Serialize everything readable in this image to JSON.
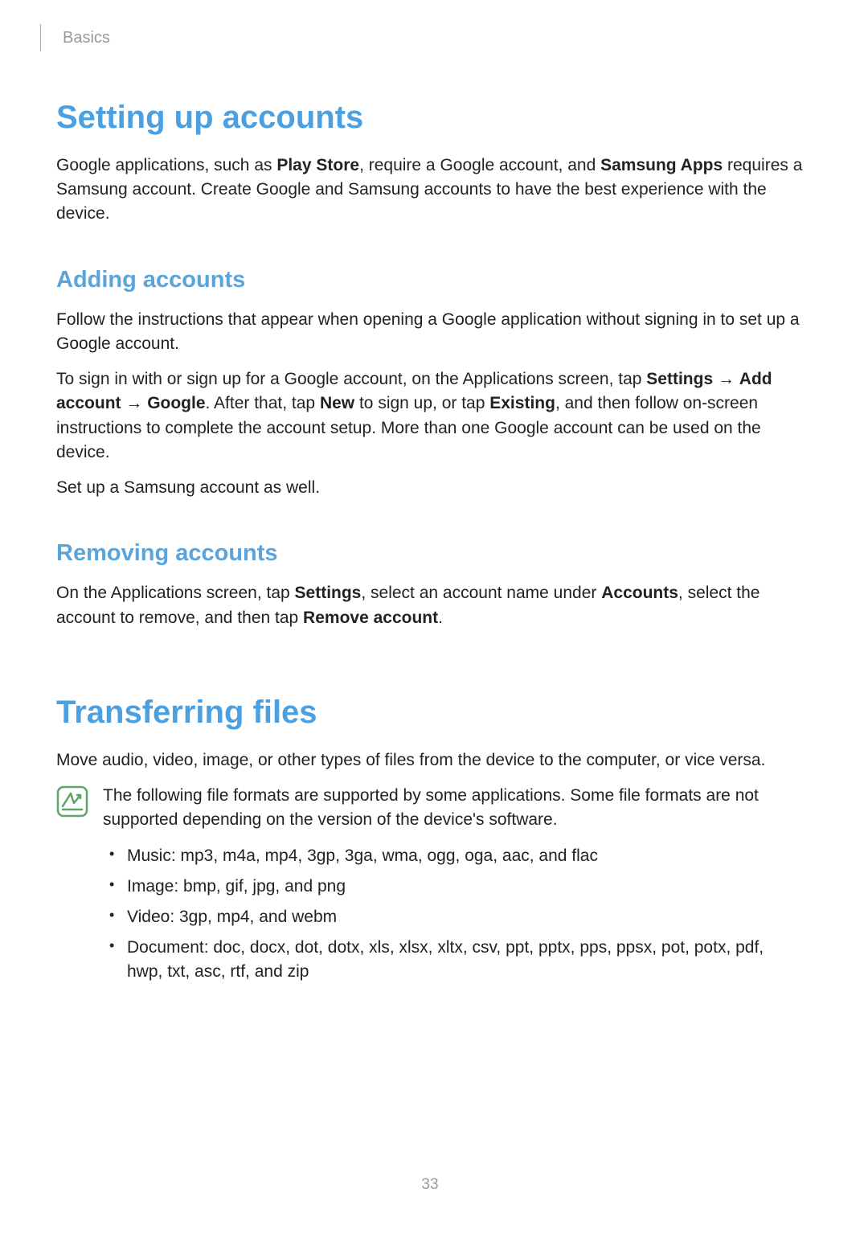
{
  "breadcrumb": "Basics",
  "section1": {
    "title": "Setting up accounts",
    "intro": {
      "t1": "Google applications, such as ",
      "b1": "Play Store",
      "t2": ", require a Google account, and ",
      "b2": "Samsung Apps",
      "t3": " requires a Samsung account. Create Google and Samsung accounts to have the best experience with the device."
    },
    "sub1": {
      "title": "Adding accounts",
      "p1": "Follow the instructions that appear when opening a Google application without signing in to set up a Google account.",
      "p2": {
        "t1": "To sign in with or sign up for a Google account, on the Applications screen, tap ",
        "b1": "Settings",
        "arrow1": " → ",
        "b2": "Add account",
        "arrow2": " → ",
        "b3": "Google",
        "t2": ". After that, tap ",
        "b4": "New",
        "t3": " to sign up, or tap ",
        "b5": "Existing",
        "t4": ", and then follow on-screen instructions to complete the account setup. More than one Google account can be used on the device."
      },
      "p3": "Set up a Samsung account as well."
    },
    "sub2": {
      "title": "Removing accounts",
      "p1": {
        "t1": "On the Applications screen, tap ",
        "b1": "Settings",
        "t2": ", select an account name under ",
        "b2": "Accounts",
        "t3": ", select the account to remove, and then tap ",
        "b3": "Remove account",
        "t4": "."
      }
    }
  },
  "section2": {
    "title": "Transferring files",
    "intro": "Move audio, video, image, or other types of files from the device to the computer, or vice versa.",
    "note": "The following file formats are supported by some applications. Some file formats are not supported depending on the version of the device's software.",
    "bullets": [
      "Music: mp3, m4a, mp4, 3gp, 3ga, wma, ogg, oga, aac, and flac",
      "Image: bmp, gif, jpg, and png",
      "Video: 3gp, mp4, and webm",
      "Document: doc, docx, dot, dotx, xls, xlsx, xltx, csv, ppt, pptx, pps, ppsx, pot, potx, pdf, hwp, txt, asc, rtf, and zip"
    ]
  },
  "pageNumber": "33"
}
